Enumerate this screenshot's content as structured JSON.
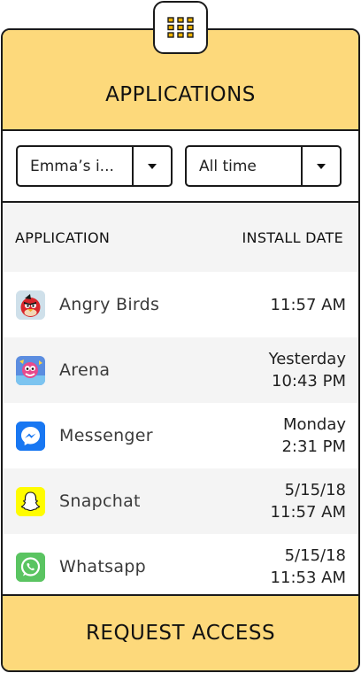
{
  "header": {
    "title": "APPLICATIONS"
  },
  "filters": {
    "device": {
      "selected": "Emma’s i..."
    },
    "period": {
      "selected": "All time"
    }
  },
  "table": {
    "columns": {
      "application": "APPLICATION",
      "install_date": "INSTALL DATE"
    },
    "rows": [
      {
        "name": "Angry Birds",
        "icon": "angry-birds-icon",
        "date_line1": "",
        "date_line2": "11:57 AM"
      },
      {
        "name": "Arena",
        "icon": "arena-icon",
        "date_line1": "Yesterday",
        "date_line2": "10:43 PM"
      },
      {
        "name": "Messenger",
        "icon": "messenger-icon",
        "date_line1": "Monday",
        "date_line2": "2:31 PM"
      },
      {
        "name": "Snapchat",
        "icon": "snapchat-icon",
        "date_line1": "5/15/18",
        "date_line2": "11:57 AM"
      },
      {
        "name": "Whatsapp",
        "icon": "whatsapp-icon",
        "date_line1": "5/15/18",
        "date_line2": "11:53 AM"
      }
    ]
  },
  "footer": {
    "label": "REQUEST ACCESS"
  },
  "colors": {
    "accent": "#fdd97b",
    "border": "#1a1a1a",
    "row_alt": "#f4f4f4",
    "messenger": "#1877f2",
    "snapchat": "#fffc00",
    "whatsapp": "#5ac461",
    "grid_icon": "#f2b400"
  }
}
